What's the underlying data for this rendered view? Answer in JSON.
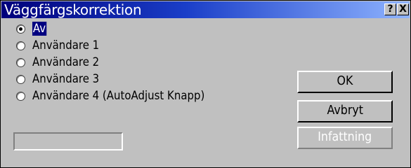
{
  "window": {
    "title": "Väggfärgskorrektion",
    "help_label": "?",
    "close_label": "X"
  },
  "options": [
    {
      "label": "Av",
      "checked": true
    },
    {
      "label": "Användare 1",
      "checked": false
    },
    {
      "label": "Användare 2",
      "checked": false
    },
    {
      "label": "Användare 3",
      "checked": false
    },
    {
      "label": "Användare 4 (AutoAdjust Knapp)",
      "checked": false
    }
  ],
  "name_field": {
    "value": ""
  },
  "buttons": {
    "ok": "OK",
    "cancel": "Avbryt",
    "insert": "Infattning"
  },
  "colors": {
    "title_gradient_start": "#00007b",
    "title_gradient_end": "#8fb4ff",
    "face": "#c0c0c0",
    "selection": "#000080"
  }
}
